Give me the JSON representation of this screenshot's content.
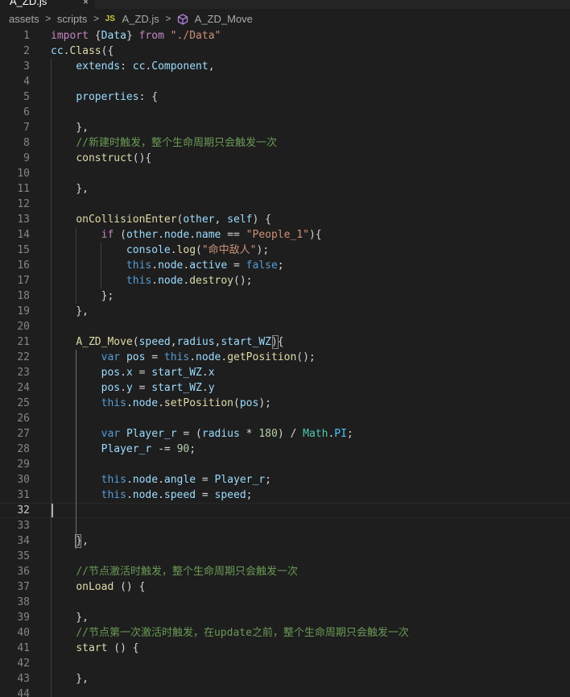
{
  "tab": {
    "label": "A_ZD.js",
    "close_glyph": "×"
  },
  "breadcrumb": {
    "items": [
      "assets",
      "scripts",
      "A_ZD.js",
      "A_ZD_Move"
    ],
    "separator": ">",
    "js_badge": "JS"
  },
  "colors": {
    "background": "#1e1e1e",
    "keyword": "#569cd6",
    "control": "#c586c0",
    "string": "#ce9178",
    "function": "#dcdcaa",
    "property": "#9cdcfe",
    "variable": "#9cdcfe",
    "type": "#4ec9b0",
    "number": "#b5cea8",
    "comment": "#6a9955",
    "constant": "#4fc1ff",
    "text": "#d4d4d4"
  },
  "editor": {
    "active_line": 32,
    "lines": [
      {
        "n": "1",
        "t": [
          [
            "import ",
            "c"
          ],
          [
            "{",
            "t"
          ],
          [
            "Data",
            "v"
          ],
          [
            "} ",
            "t"
          ],
          [
            "from ",
            "c"
          ],
          [
            "\"./Data\"",
            "s"
          ]
        ]
      },
      {
        "n": "2",
        "t": [
          [
            "cc",
            "v"
          ],
          [
            ".",
            "t"
          ],
          [
            "Class",
            "f"
          ],
          [
            "({",
            "t"
          ]
        ]
      },
      {
        "n": "3",
        "t": [
          [
            "    ",
            "t"
          ],
          [
            "extends",
            "v"
          ],
          [
            ": ",
            "t"
          ],
          [
            "cc",
            "v"
          ],
          [
            ".",
            "t"
          ],
          [
            "Component",
            "v"
          ],
          [
            ",",
            "t"
          ]
        ]
      },
      {
        "n": "4",
        "t": []
      },
      {
        "n": "5",
        "t": [
          [
            "    ",
            "t"
          ],
          [
            "properties",
            "v"
          ],
          [
            ": {",
            "t"
          ]
        ]
      },
      {
        "n": "6",
        "t": []
      },
      {
        "n": "7",
        "t": [
          [
            "    },",
            "t"
          ]
        ]
      },
      {
        "n": "8",
        "t": [
          [
            "    ",
            "t"
          ],
          [
            "//新建时触发，整个生命周期只会触发一次",
            "m"
          ]
        ]
      },
      {
        "n": "9",
        "t": [
          [
            "    ",
            "t"
          ],
          [
            "construct",
            "f"
          ],
          [
            "(){",
            "t"
          ]
        ]
      },
      {
        "n": "10",
        "t": []
      },
      {
        "n": "11",
        "t": [
          [
            "    },",
            "t"
          ]
        ]
      },
      {
        "n": "12",
        "t": []
      },
      {
        "n": "13",
        "t": [
          [
            "    ",
            "t"
          ],
          [
            "onCollisionEnter",
            "f"
          ],
          [
            "(",
            "t"
          ],
          [
            "other",
            "v"
          ],
          [
            ", ",
            "t"
          ],
          [
            "self",
            "v"
          ],
          [
            ") {",
            "t"
          ]
        ]
      },
      {
        "n": "14",
        "t": [
          [
            "        ",
            "t"
          ],
          [
            "if ",
            "c"
          ],
          [
            "(",
            "t"
          ],
          [
            "other",
            "v"
          ],
          [
            ".",
            "t"
          ],
          [
            "node",
            "v"
          ],
          [
            ".",
            "t"
          ],
          [
            "name",
            "v"
          ],
          [
            " == ",
            "t"
          ],
          [
            "\"People_1\"",
            "s"
          ],
          [
            "){",
            "t"
          ]
        ]
      },
      {
        "n": "15",
        "t": [
          [
            "            ",
            "t"
          ],
          [
            "console",
            "v"
          ],
          [
            ".",
            "t"
          ],
          [
            "log",
            "f"
          ],
          [
            "(",
            "t"
          ],
          [
            "\"命中敌人\"",
            "s"
          ],
          [
            ");",
            "t"
          ]
        ]
      },
      {
        "n": "16",
        "t": [
          [
            "            ",
            "t"
          ],
          [
            "this",
            "k"
          ],
          [
            ".",
            "t"
          ],
          [
            "node",
            "v"
          ],
          [
            ".",
            "t"
          ],
          [
            "active",
            "v"
          ],
          [
            " = ",
            "t"
          ],
          [
            "false",
            "k"
          ],
          [
            ";",
            "t"
          ]
        ]
      },
      {
        "n": "17",
        "t": [
          [
            "            ",
            "t"
          ],
          [
            "this",
            "k"
          ],
          [
            ".",
            "t"
          ],
          [
            "node",
            "v"
          ],
          [
            ".",
            "t"
          ],
          [
            "destroy",
            "f"
          ],
          [
            "();",
            "t"
          ]
        ]
      },
      {
        "n": "18",
        "t": [
          [
            "        };",
            "t"
          ]
        ]
      },
      {
        "n": "19",
        "t": [
          [
            "    },",
            "t"
          ]
        ]
      },
      {
        "n": "20",
        "t": []
      },
      {
        "n": "21",
        "t": [
          [
            "    ",
            "t"
          ],
          [
            "A_ZD_Move",
            "f"
          ],
          [
            "(",
            "t"
          ],
          [
            "speed",
            "v"
          ],
          [
            ",",
            "t"
          ],
          [
            "radius",
            "v"
          ],
          [
            ",",
            "t"
          ],
          [
            "start_WZ",
            "v"
          ],
          [
            "){",
            "t"
          ]
        ]
      },
      {
        "n": "22",
        "t": [
          [
            "        ",
            "t"
          ],
          [
            "var ",
            "k"
          ],
          [
            "pos",
            "v"
          ],
          [
            " = ",
            "t"
          ],
          [
            "this",
            "k"
          ],
          [
            ".",
            "t"
          ],
          [
            "node",
            "v"
          ],
          [
            ".",
            "t"
          ],
          [
            "getPosition",
            "f"
          ],
          [
            "();",
            "t"
          ]
        ]
      },
      {
        "n": "23",
        "t": [
          [
            "        ",
            "t"
          ],
          [
            "pos",
            "v"
          ],
          [
            ".",
            "t"
          ],
          [
            "x",
            "v"
          ],
          [
            " = ",
            "t"
          ],
          [
            "start_WZ",
            "v"
          ],
          [
            ".",
            "t"
          ],
          [
            "x",
            "v"
          ]
        ]
      },
      {
        "n": "24",
        "t": [
          [
            "        ",
            "t"
          ],
          [
            "pos",
            "v"
          ],
          [
            ".",
            "t"
          ],
          [
            "y",
            "v"
          ],
          [
            " = ",
            "t"
          ],
          [
            "start_WZ",
            "v"
          ],
          [
            ".",
            "t"
          ],
          [
            "y",
            "v"
          ]
        ]
      },
      {
        "n": "25",
        "t": [
          [
            "        ",
            "t"
          ],
          [
            "this",
            "k"
          ],
          [
            ".",
            "t"
          ],
          [
            "node",
            "v"
          ],
          [
            ".",
            "t"
          ],
          [
            "setPosition",
            "f"
          ],
          [
            "(",
            "t"
          ],
          [
            "pos",
            "v"
          ],
          [
            ");",
            "t"
          ]
        ]
      },
      {
        "n": "26",
        "t": []
      },
      {
        "n": "27",
        "t": [
          [
            "        ",
            "t"
          ],
          [
            "var ",
            "k"
          ],
          [
            "Player_r",
            "v"
          ],
          [
            " = (",
            "t"
          ],
          [
            "radius",
            "v"
          ],
          [
            " * ",
            "t"
          ],
          [
            "180",
            "n"
          ],
          [
            ") / ",
            "t"
          ],
          [
            "Math",
            "y"
          ],
          [
            ".",
            "t"
          ],
          [
            "PI",
            "o"
          ],
          [
            ";",
            "t"
          ]
        ]
      },
      {
        "n": "28",
        "t": [
          [
            "        ",
            "t"
          ],
          [
            "Player_r",
            "v"
          ],
          [
            " -= ",
            "t"
          ],
          [
            "90",
            "n"
          ],
          [
            ";",
            "t"
          ]
        ]
      },
      {
        "n": "29",
        "t": []
      },
      {
        "n": "30",
        "t": [
          [
            "        ",
            "t"
          ],
          [
            "this",
            "k"
          ],
          [
            ".",
            "t"
          ],
          [
            "node",
            "v"
          ],
          [
            ".",
            "t"
          ],
          [
            "angle",
            "v"
          ],
          [
            " = ",
            "t"
          ],
          [
            "Player_r",
            "v"
          ],
          [
            ";",
            "t"
          ]
        ]
      },
      {
        "n": "31",
        "t": [
          [
            "        ",
            "t"
          ],
          [
            "this",
            "k"
          ],
          [
            ".",
            "t"
          ],
          [
            "node",
            "v"
          ],
          [
            ".",
            "t"
          ],
          [
            "speed",
            "v"
          ],
          [
            " = ",
            "t"
          ],
          [
            "speed",
            "v"
          ],
          [
            ";",
            "t"
          ]
        ]
      },
      {
        "n": "32",
        "t": []
      },
      {
        "n": "33",
        "t": []
      },
      {
        "n": "34",
        "t": [
          [
            "    },",
            "t"
          ]
        ]
      },
      {
        "n": "35",
        "t": []
      },
      {
        "n": "36",
        "t": [
          [
            "    ",
            "t"
          ],
          [
            "//节点激活时触发，整个生命周期只会触发一次",
            "m"
          ]
        ]
      },
      {
        "n": "37",
        "t": [
          [
            "    ",
            "t"
          ],
          [
            "onLoad",
            "f"
          ],
          [
            " () {",
            "t"
          ]
        ]
      },
      {
        "n": "38",
        "t": []
      },
      {
        "n": "39",
        "t": [
          [
            "    },",
            "t"
          ]
        ]
      },
      {
        "n": "40",
        "t": [
          [
            "    ",
            "t"
          ],
          [
            "//节点第一次激活时触发，在update之前，整个生命周期只会触发一次",
            "m"
          ]
        ]
      },
      {
        "n": "41",
        "t": [
          [
            "    ",
            "t"
          ],
          [
            "start",
            "f"
          ],
          [
            " () {",
            "t"
          ]
        ]
      },
      {
        "n": "42",
        "t": []
      },
      {
        "n": "43",
        "t": [
          [
            "    },",
            "t"
          ]
        ]
      },
      {
        "n": "44",
        "t": []
      }
    ]
  }
}
